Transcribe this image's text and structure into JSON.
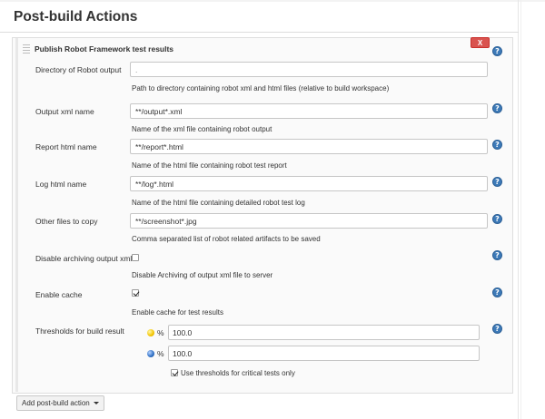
{
  "section": {
    "title": "Post-build Actions"
  },
  "step": {
    "title": "Publish Robot Framework test results",
    "close_label": "X"
  },
  "help_glyph": "?",
  "fields": {
    "directory": {
      "label": "Directory of Robot output",
      "value": ".",
      "description": "Path to directory containing robot xml and html files (relative to build workspace)"
    },
    "output_xml": {
      "label": "Output xml name",
      "value": "**/output*.xml",
      "description": "Name of the xml file containing robot output"
    },
    "report_html": {
      "label": "Report html name",
      "value": "**/report*.html",
      "description": "Name of the html file containing robot test report"
    },
    "log_html": {
      "label": "Log html name",
      "value": "**/log*.html",
      "description": "Name of the html file containing detailed robot test log"
    },
    "other_files": {
      "label": "Other files to copy",
      "value": "**/screenshot*.jpg",
      "description": "Comma separated list of robot related artifacts to be saved"
    },
    "disable_archiving": {
      "label": "Disable archiving output xml",
      "checked": false,
      "description": "Disable Archiving of output xml file to server"
    },
    "enable_cache": {
      "label": "Enable cache",
      "checked": true,
      "description": "Enable cache for test results"
    },
    "thresholds": {
      "label": "Thresholds for build result",
      "unstable": {
        "icon": "yellow-ball-icon",
        "unit": "%",
        "value": "100.0"
      },
      "pass": {
        "icon": "blue-ball-icon",
        "unit": "%",
        "value": "100.0"
      },
      "critical_only": {
        "checked": true,
        "label": "Use thresholds for critical tests only"
      }
    }
  },
  "footer": {
    "add_button_label": "Add post-build action"
  },
  "colors": {
    "close_button": "#d9534f",
    "help_icon": "#3d7ab8",
    "panel_background": "#fafafa"
  }
}
